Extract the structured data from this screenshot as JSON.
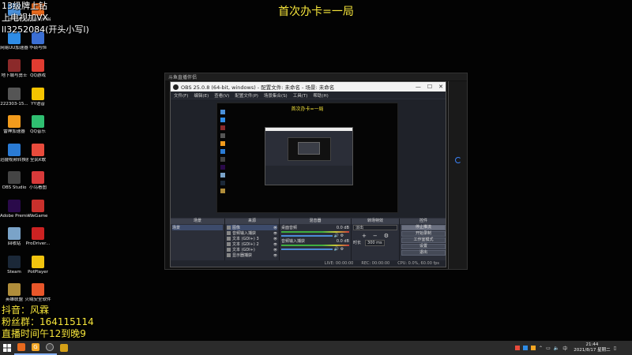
{
  "overlay": {
    "top_left_lines": [
      "13级牌上钻",
      "上电视加VX",
      "ll3252084(开头小写l)"
    ],
    "title": "首次办卡=一局",
    "bottom_left_lines": [
      "抖音：风霖",
      "粉丝群：164115114",
      "直播时间午12到晚9"
    ]
  },
  "desktop_icons": [
    {
      "label": "此电脑",
      "color": "#4a90d9"
    },
    {
      "label": "斗鱼直播伴侣",
      "color": "#e86a1e"
    },
    {
      "label": "网易UU加速器",
      "color": "#2e8ce6"
    },
    {
      "label": "华硕与恒",
      "color": "#3b6fd4"
    },
    {
      "label": "地下城与勇士",
      "color": "#8b2a2a"
    },
    {
      "label": "QQ游戏",
      "color": "#e03c31"
    },
    {
      "label": "222303-15...",
      "color": "#555"
    },
    {
      "label": "YY语音",
      "color": "#f5c400"
    },
    {
      "label": "雷神加速器",
      "color": "#f29b1c"
    },
    {
      "label": "QQ音乐",
      "color": "#2fbf71"
    },
    {
      "label": "迅捷视频转换器",
      "color": "#2a7bd5"
    },
    {
      "label": "全民K歌",
      "color": "#e84b3c"
    },
    {
      "label": "OBS Studio",
      "color": "#444"
    },
    {
      "label": "小鸟看图",
      "color": "#d83a3a"
    },
    {
      "label": "Adobe Premie...",
      "color": "#2a0a4a"
    },
    {
      "label": "WeGame",
      "color": "#c9302c"
    },
    {
      "label": "回收站",
      "color": "#7aa3c8"
    },
    {
      "label": "ProDriver...",
      "color": "#c22"
    },
    {
      "label": "Steam",
      "color": "#1b2838"
    },
    {
      "label": "PotPlayer",
      "color": "#f1c40f"
    },
    {
      "label": "英雄联盟",
      "color": "#b08d3a"
    },
    {
      "label": "火绒安全软件",
      "color": "#e8562a"
    }
  ],
  "obs": {
    "outer_bar_text": "斗鱼直播伴侣",
    "title": "OBS 25.0.8 (64-bit, windows) - 配置文件: 未命名 - 场景: 未命名",
    "menu": [
      "文件(F)",
      "编辑(E)",
      "查看(V)",
      "配置文件(P)",
      "场景集合(S)",
      "工具(T)",
      "帮助(H)"
    ],
    "preview_title": "首次办卡=一局",
    "docks": {
      "scenes_header": "场景",
      "scenes": [
        "场景"
      ],
      "sources_header": "来源",
      "sources": [
        "图像",
        "音频输入捕获",
        "文本 (GDI+) 3",
        "文本 (GDI+) 2",
        "文本 (GDI+)",
        "显示器捕获"
      ],
      "mixer_header": "混音器",
      "mixer": [
        {
          "name": "桌面音频",
          "level": "0.0 dB"
        },
        {
          "name": "音频输入捕获",
          "level": "0.0 dB"
        }
      ],
      "transitions_header": "转场特效",
      "transition_value": "淡出",
      "duration_label": "时长",
      "duration_value": "300 ms",
      "controls_header": "控件",
      "controls": [
        "停止推流",
        "开始录制",
        "工作室模式",
        "设置",
        "退出"
      ]
    },
    "status": {
      "live": "LIVE: 00:00:00",
      "rec": "REC: 00:00:00",
      "cpu": "CPU: 0.0%, 60.00 fps"
    }
  },
  "taskbar": {
    "time": "21:44",
    "date": "2021/8/17 星期二",
    "ime": "中"
  }
}
